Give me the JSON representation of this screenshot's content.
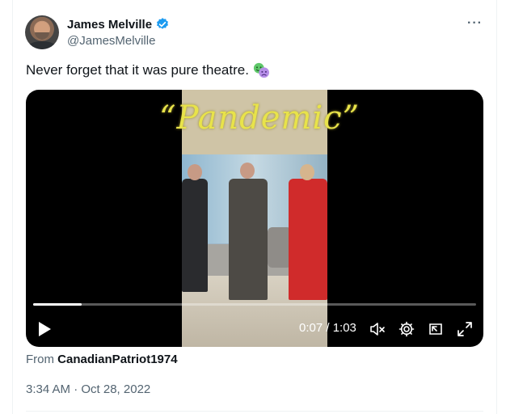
{
  "author": {
    "display_name": "James Melville",
    "handle": "@JamesMelville",
    "verified": true
  },
  "tweet": {
    "text": "Never forget that it was pure theatre.",
    "emoji": "performing-arts-masks"
  },
  "video": {
    "overlay_title": "“Pandemic”",
    "time_display": "0:07 / 1:03",
    "progress": 0.11
  },
  "source": {
    "prefix": "From",
    "account": "CanadianPatriot1974"
  },
  "timestamp": "3:34 AM · Oct 28, 2022",
  "colors": {
    "accent": "#1d9bf0",
    "text_primary": "#0f1419",
    "text_secondary": "#536471",
    "overlay_text": "#e8e34a"
  }
}
